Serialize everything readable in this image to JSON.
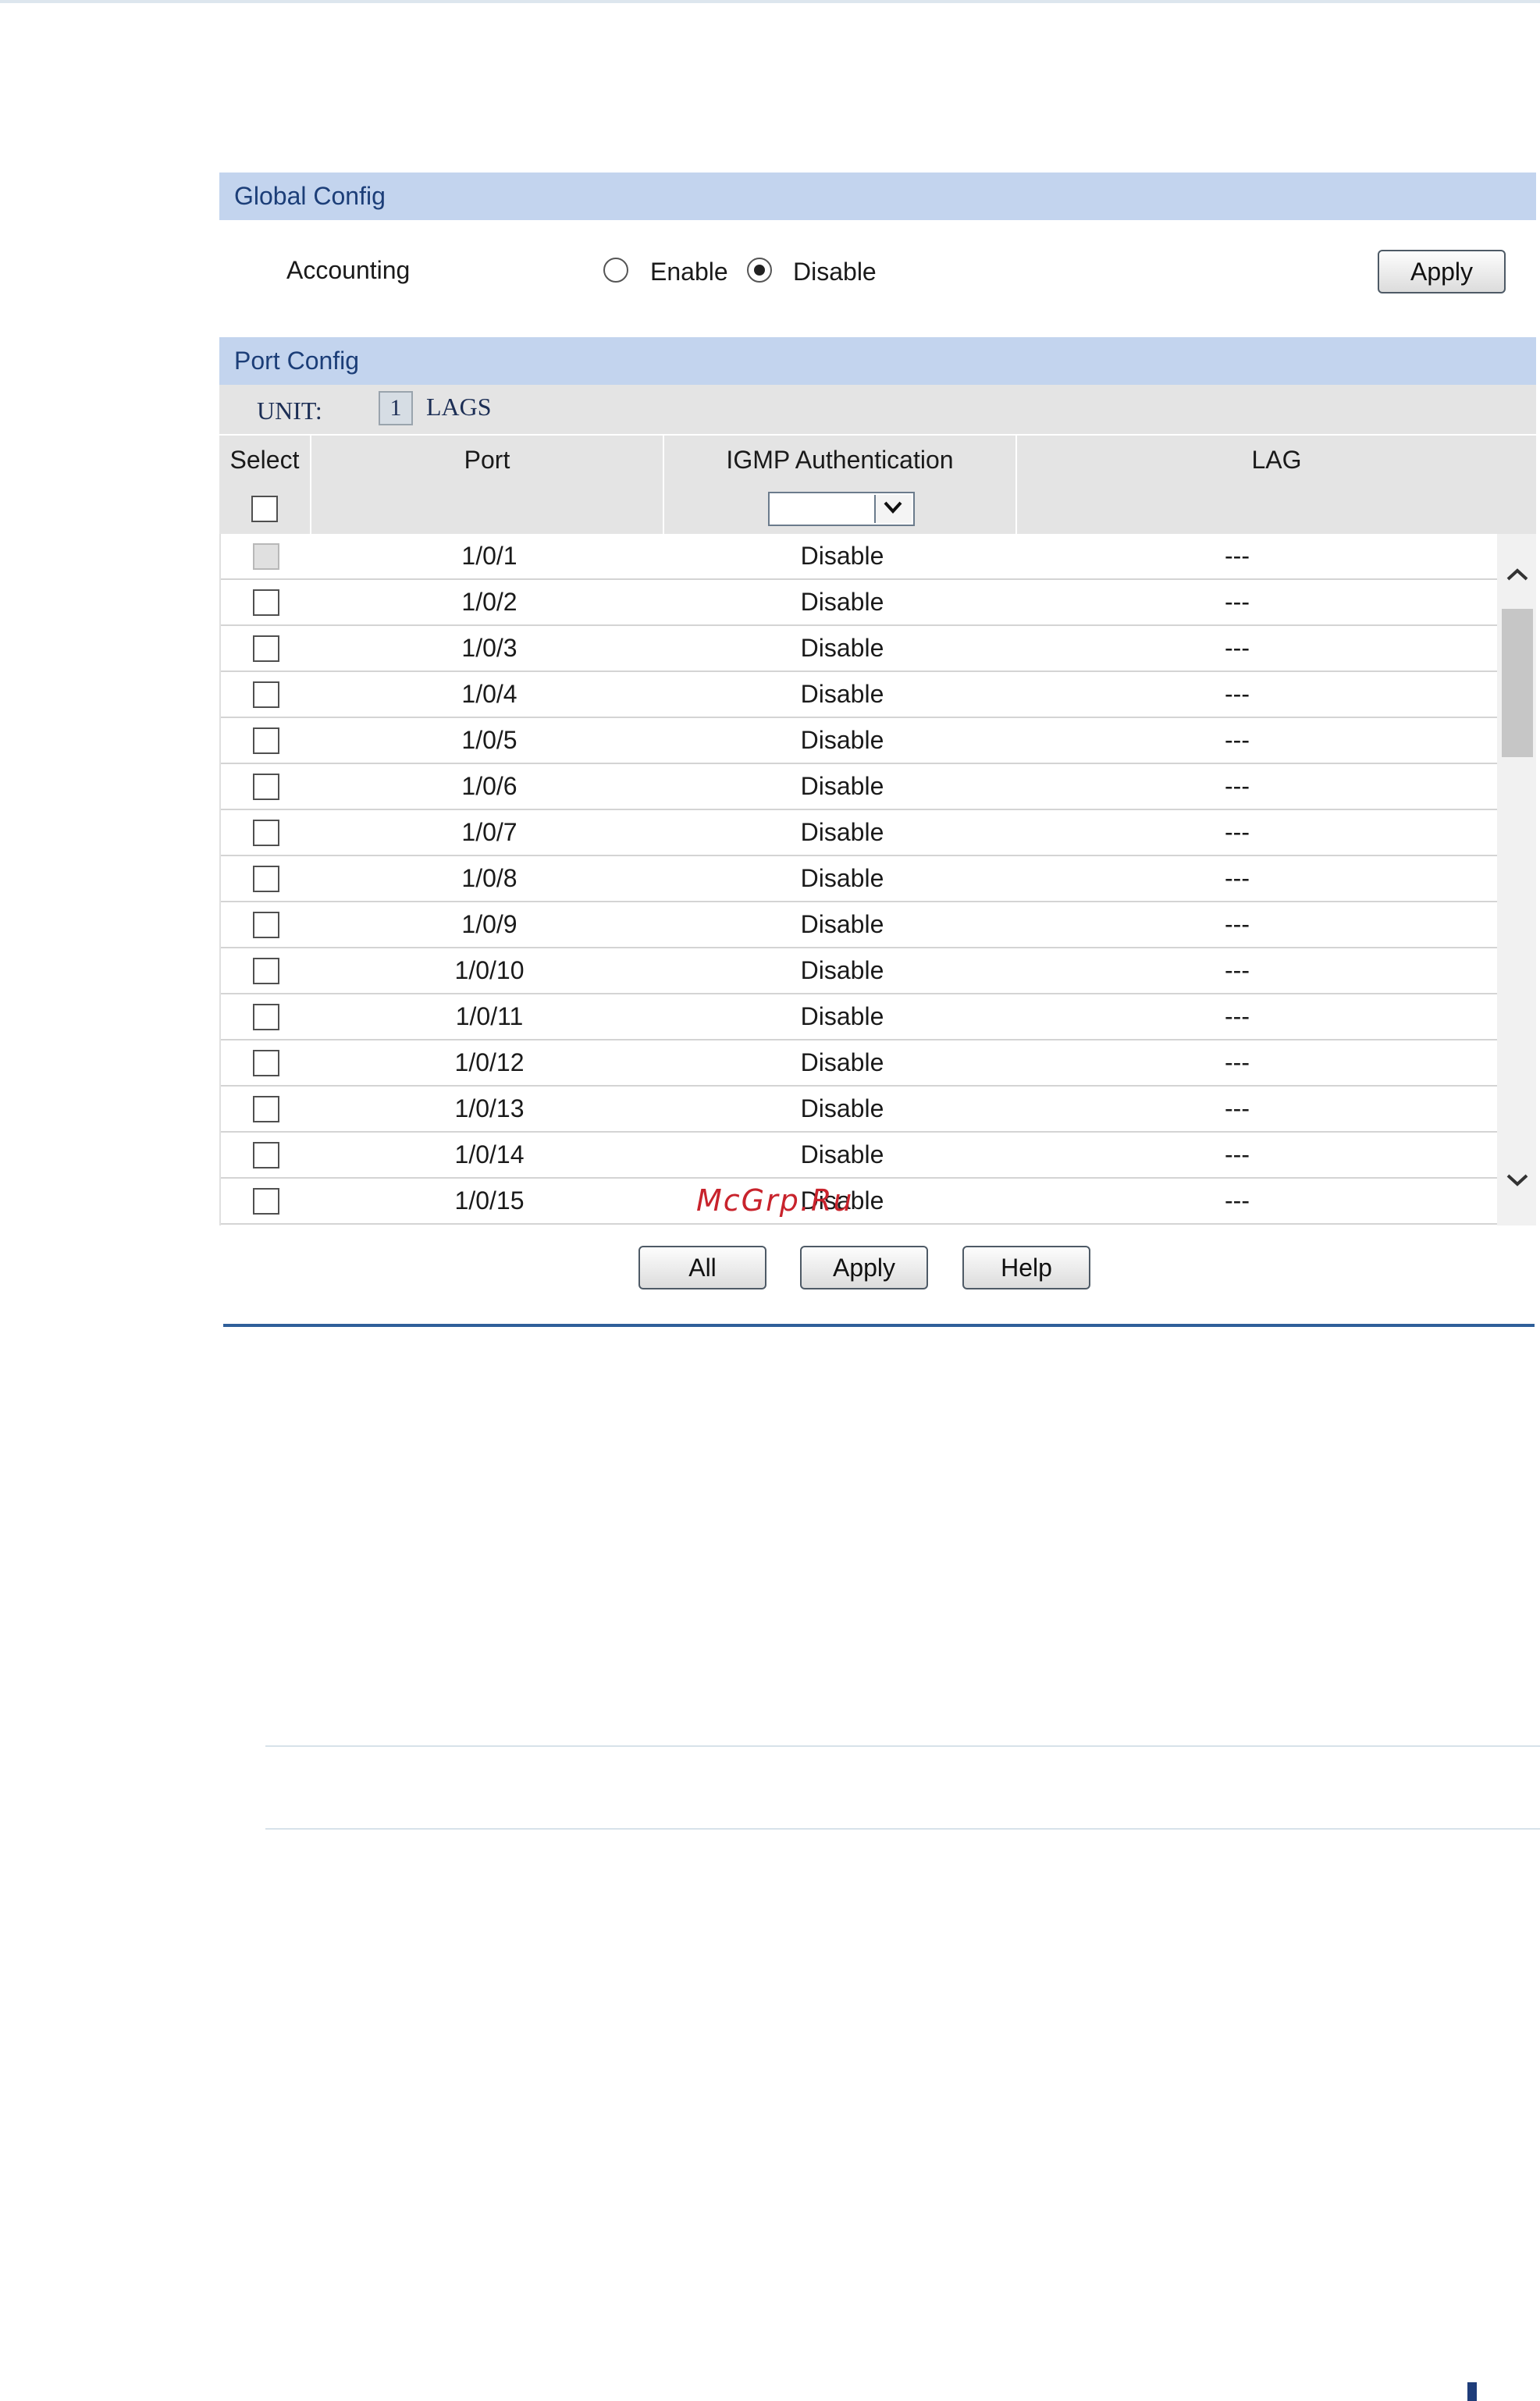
{
  "global_config": {
    "title": "Global Config",
    "accounting_label": "Accounting",
    "enable_label": "Enable",
    "disable_label": "Disable",
    "selected": "Disable",
    "apply_label": "Apply"
  },
  "port_config": {
    "title": "Port Config",
    "unit_label": "UNIT:",
    "unit_value": "1",
    "lags_label": "LAGS",
    "columns": {
      "select": "Select",
      "port": "Port",
      "igmp": "IGMP Authentication",
      "lag": "LAG"
    },
    "filter_select_value": "",
    "rows": [
      {
        "port": "1/0/1",
        "igmp": "Disable",
        "lag": "---",
        "checkbox_disabled": true
      },
      {
        "port": "1/0/2",
        "igmp": "Disable",
        "lag": "---",
        "checkbox_disabled": false
      },
      {
        "port": "1/0/3",
        "igmp": "Disable",
        "lag": "---",
        "checkbox_disabled": false
      },
      {
        "port": "1/0/4",
        "igmp": "Disable",
        "lag": "---",
        "checkbox_disabled": false
      },
      {
        "port": "1/0/5",
        "igmp": "Disable",
        "lag": "---",
        "checkbox_disabled": false
      },
      {
        "port": "1/0/6",
        "igmp": "Disable",
        "lag": "---",
        "checkbox_disabled": false
      },
      {
        "port": "1/0/7",
        "igmp": "Disable",
        "lag": "---",
        "checkbox_disabled": false
      },
      {
        "port": "1/0/8",
        "igmp": "Disable",
        "lag": "---",
        "checkbox_disabled": false
      },
      {
        "port": "1/0/9",
        "igmp": "Disable",
        "lag": "---",
        "checkbox_disabled": false
      },
      {
        "port": "1/0/10",
        "igmp": "Disable",
        "lag": "---",
        "checkbox_disabled": false
      },
      {
        "port": "1/0/11",
        "igmp": "Disable",
        "lag": "---",
        "checkbox_disabled": false
      },
      {
        "port": "1/0/12",
        "igmp": "Disable",
        "lag": "---",
        "checkbox_disabled": false
      },
      {
        "port": "1/0/13",
        "igmp": "Disable",
        "lag": "---",
        "checkbox_disabled": false
      },
      {
        "port": "1/0/14",
        "igmp": "Disable",
        "lag": "---",
        "checkbox_disabled": false
      },
      {
        "port": "1/0/15",
        "igmp": "Disable",
        "lag": "---",
        "checkbox_disabled": false
      }
    ],
    "buttons": {
      "all": "All",
      "apply": "Apply",
      "help": "Help"
    }
  },
  "watermark": "McGrp.Ru",
  "icons": {
    "scroll_up": "chevron-up-icon",
    "scroll_down": "chevron-down-icon",
    "dropdown": "chevron-down-icon"
  },
  "colors": {
    "section_header": "#c3d4ee",
    "header_text": "#1c3e78",
    "table_header": "#e4e4e4",
    "rule": "#2f5f9a",
    "watermark": "#c8232c"
  }
}
